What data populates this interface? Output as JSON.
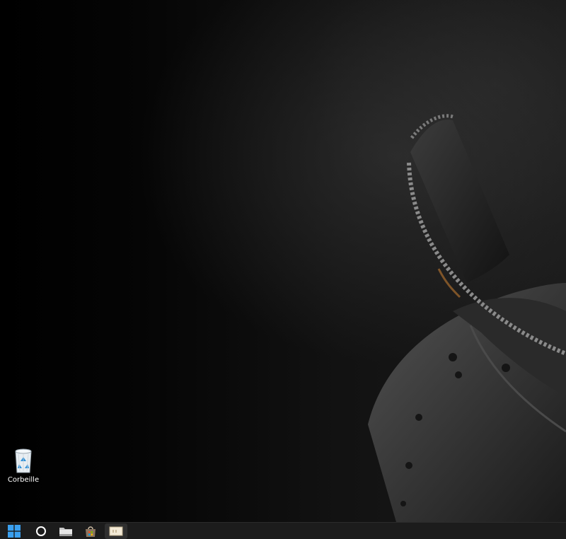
{
  "desktop": {
    "icons": [
      {
        "label": "Corbeille",
        "icon": "recycle-bin-icon"
      }
    ]
  },
  "taskbar": {
    "buttons": [
      {
        "icon": "windows-start-icon"
      },
      {
        "icon": "search-icon"
      },
      {
        "icon": "file-explorer-icon"
      },
      {
        "icon": "store-bag-icon"
      },
      {
        "icon": "app-window-icon",
        "active": true
      }
    ]
  },
  "colors": {
    "start_blue": "#3aa0f0",
    "taskbar_bg": "#1c1c1c",
    "desktop_bg": "#000000"
  }
}
